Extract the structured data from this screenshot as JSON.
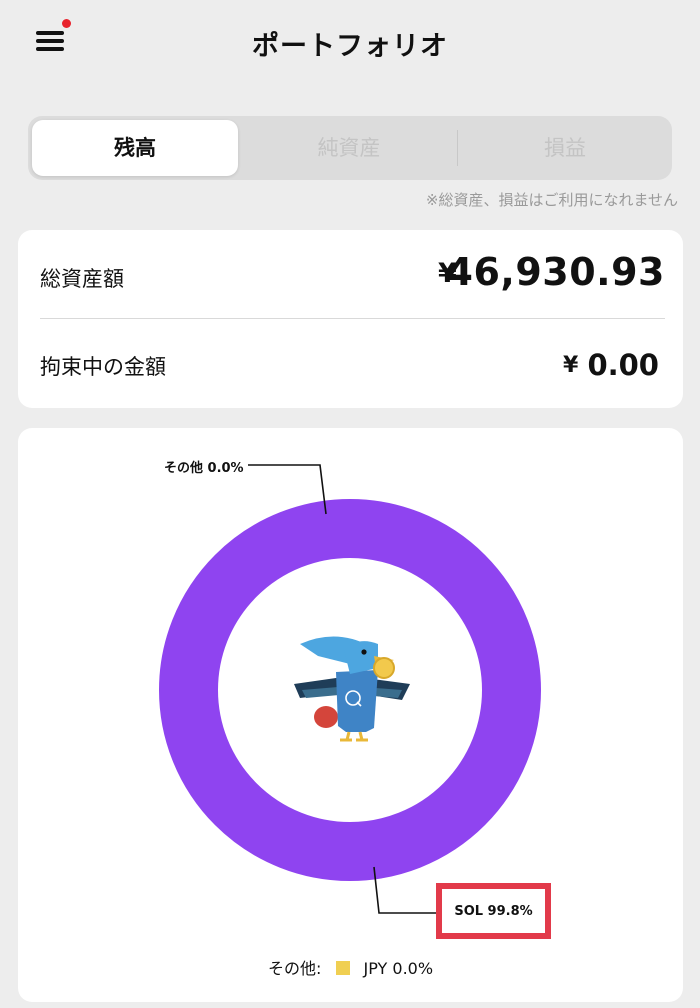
{
  "header": {
    "title": "ポートフォリオ",
    "menu_icon": "hamburger-menu-icon",
    "notification_color": "#e8232d"
  },
  "tabs": {
    "items": [
      {
        "label": "残高",
        "active": true
      },
      {
        "label": "純資産",
        "active": false
      },
      {
        "label": "損益",
        "active": false
      }
    ],
    "note": "※総資産、損益はご利用になれません"
  },
  "balance": {
    "total_label": "総資産額",
    "total_currency": "¥",
    "total_value": "46,930.93",
    "locked_label": "拘束中の金額",
    "locked_currency": "¥",
    "locked_value": "0.00"
  },
  "chart_data": {
    "type": "pie",
    "series": [
      {
        "label": "SOL",
        "value": 99.8,
        "color": "#8f44f0"
      },
      {
        "label": "その他",
        "value": 0.0
      }
    ],
    "callouts": {
      "other": "その他 0.0%",
      "sol": "SOL 99.8%"
    },
    "legend": {
      "other_label": "その他:",
      "jpy_label": "JPY 0.0%",
      "jpy_color": "#f0cf52"
    },
    "center_icon": "bird-mascot-icon"
  },
  "colors": {
    "accent": "#8f44f0",
    "highlight": "#e23a4a",
    "background": "#ededed"
  }
}
